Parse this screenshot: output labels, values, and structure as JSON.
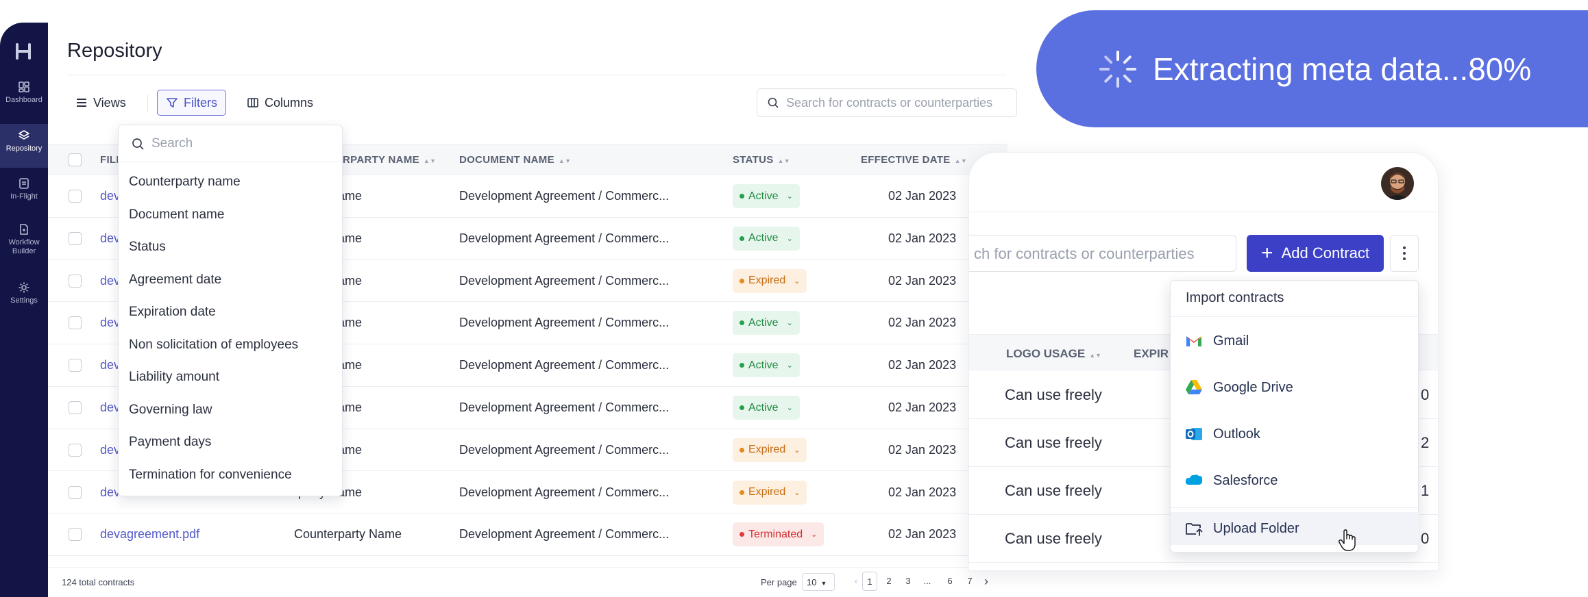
{
  "sidebar": {
    "items": [
      {
        "label": "Dashboard",
        "icon": "dashboard-icon"
      },
      {
        "label": "Repository",
        "icon": "layers-icon"
      },
      {
        "label": "In-Flight",
        "icon": "document-icon"
      },
      {
        "label": "Workflow Builder",
        "icon": "workflow-icon"
      },
      {
        "label": "Settings",
        "icon": "gear-icon"
      }
    ],
    "active": "Repository"
  },
  "header": {
    "title": "Repository"
  },
  "toolbar": {
    "views_label": "Views",
    "filters_label": "Filters",
    "columns_label": "Columns",
    "search_placeholder": "Search for contracts or counterparties"
  },
  "table": {
    "columns": [
      "FILE NAME",
      "COUNTERPARTY NAME",
      "DOCUMENT NAME",
      "STATUS",
      "EFFECTIVE DATE"
    ],
    "visible_header_fragments": {
      "file": "FILE",
      "counterparty": "RPARTY NAME"
    },
    "rows": [
      {
        "file": "dev",
        "counterparty": "rparty Name",
        "document": "Development Agreement / Commerc...",
        "status": "Active",
        "date": "02 Jan 2023"
      },
      {
        "file": "dev",
        "counterparty": "rparty Name",
        "document": "Development Agreement / Commerc...",
        "status": "Active",
        "date": "02 Jan 2023"
      },
      {
        "file": "dev",
        "counterparty": "rparty Name",
        "document": "Development Agreement / Commerc...",
        "status": "Expired",
        "date": "02 Jan 2023"
      },
      {
        "file": "dev",
        "counterparty": "rparty Name",
        "document": "Development Agreement / Commerc...",
        "status": "Active",
        "date": "02 Jan 2023"
      },
      {
        "file": "dev",
        "counterparty": "rparty Name",
        "document": "Development Agreement / Commerc...",
        "status": "Active",
        "date": "02 Jan 2023"
      },
      {
        "file": "dev",
        "counterparty": "rparty Name",
        "document": "Development Agreement / Commerc...",
        "status": "Active",
        "date": "02 Jan 2023"
      },
      {
        "file": "dev",
        "counterparty": "rparty Name",
        "document": "Development Agreement / Commerc...",
        "status": "Expired",
        "date": "02 Jan 2023"
      },
      {
        "file": "dev",
        "counterparty": "rparty Name",
        "document": "Development Agreement / Commerc...",
        "status": "Expired",
        "date": "02 Jan 2023"
      },
      {
        "file": "devagreement.pdf",
        "counterparty": "Counterparty Name",
        "document": "Development Agreement / Commerc...",
        "status": "Terminated",
        "date": "02 Jan 2023"
      }
    ]
  },
  "footer": {
    "total": "124 total contracts",
    "per_page_label": "Per page",
    "per_page_value": "10",
    "pages": [
      "1",
      "2",
      "3",
      "...",
      "6",
      "7"
    ],
    "current_page": "1"
  },
  "filter_menu": {
    "search_placeholder": "Search",
    "items": [
      "Counterparty name",
      "Document name",
      "Status",
      "Agreement date",
      "Expiration date",
      "Non solicitation of employees",
      "Liability amount",
      "Governing law",
      "Payment days",
      "Termination for convenience"
    ]
  },
  "banner": {
    "text": "Extracting meta data...80%",
    "progress": 80
  },
  "card": {
    "search_placeholder": "ch for contracts or counterparties",
    "add_button": "Add Contract",
    "columns": [
      "LOGO USAGE",
      "EXPIR"
    ],
    "rows": [
      {
        "logo_usage": "Can use freely",
        "right": "0"
      },
      {
        "logo_usage": "Can use freely",
        "right": "2"
      },
      {
        "logo_usage": "Can use freely",
        "right": "1"
      },
      {
        "logo_usage": "Can use freely",
        "right": "0"
      }
    ]
  },
  "import_menu": {
    "title": "Import contracts",
    "items": [
      {
        "label": "Gmail",
        "icon": "gmail-icon"
      },
      {
        "label": "Google Drive",
        "icon": "google-drive-icon"
      },
      {
        "label": "Outlook",
        "icon": "outlook-icon"
      },
      {
        "label": "Salesforce",
        "icon": "salesforce-icon"
      },
      {
        "label": "Upload Folder",
        "icon": "upload-folder-icon"
      }
    ]
  },
  "colors": {
    "sidebar": "#121545",
    "accent": "#3c40c6",
    "banner": "#5a6fe0",
    "active": "#218a44",
    "expired": "#c76b12",
    "terminated": "#d03030"
  }
}
